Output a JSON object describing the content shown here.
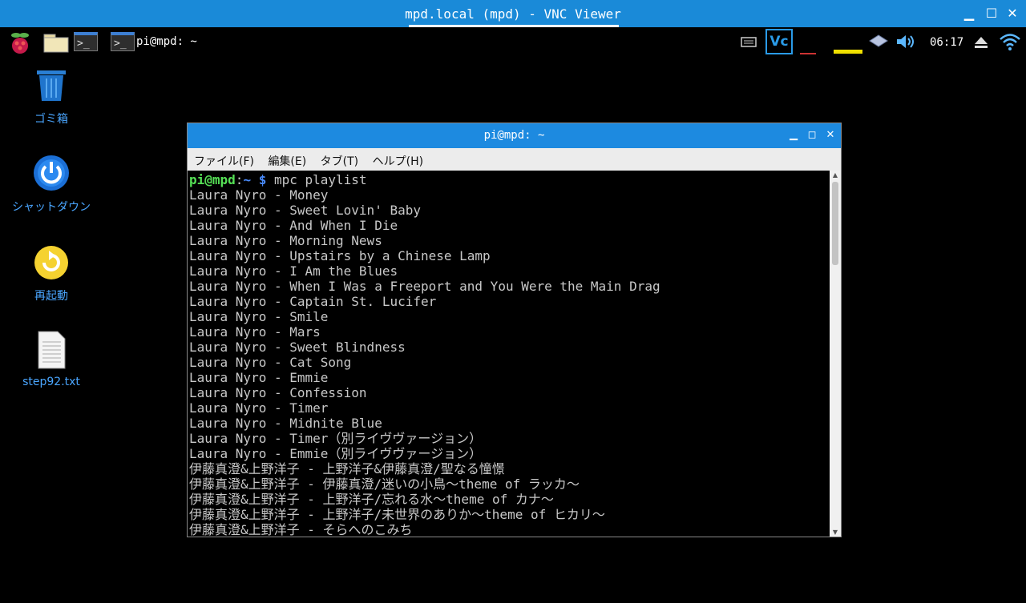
{
  "vnc_window": {
    "title": "mpd.local (mpd) - VNC Viewer"
  },
  "taskbar": {
    "active_task_label": "pi@mpd: ~",
    "clock": "06:17",
    "vnc_badge": "Vc"
  },
  "desktop_icons": [
    {
      "label": "ゴミ箱"
    },
    {
      "label": "シャットダウン"
    },
    {
      "label": "再起動"
    },
    {
      "label": "step92.txt"
    }
  ],
  "terminal": {
    "title": "pi@mpd: ~",
    "menu": [
      "ファイル(F)",
      "編集(E)",
      "タブ(T)",
      "ヘルプ(H)"
    ],
    "prompt_user": "pi@mpd",
    "prompt_sep": ":",
    "prompt_path": "~ $",
    "command": " mpc playlist",
    "lines": [
      "Laura Nyro - Money",
      "Laura Nyro - Sweet Lovin' Baby",
      "Laura Nyro - And When I Die",
      "Laura Nyro - Morning News",
      "Laura Nyro - Upstairs by a Chinese Lamp",
      "Laura Nyro - I Am the Blues",
      "Laura Nyro - When I Was a Freeport and You Were the Main Drag",
      "Laura Nyro - Captain St. Lucifer",
      "Laura Nyro - Smile",
      "Laura Nyro - Mars",
      "Laura Nyro - Sweet Blindness",
      "Laura Nyro - Cat Song",
      "Laura Nyro - Emmie",
      "Laura Nyro - Confession",
      "Laura Nyro - Timer",
      "Laura Nyro - Midnite Blue",
      "Laura Nyro - Timer（別ライヴヴァージョン）",
      "Laura Nyro - Emmie（別ライヴヴァージョン）",
      "伊藤真澄&上野洋子 - 上野洋子&伊藤真澄/聖なる憧憬",
      "伊藤真澄&上野洋子 - 伊藤真澄/迷いの小鳥～theme of ラッカ～",
      "伊藤真澄&上野洋子 - 上野洋子/忘れる水～theme of カナ～",
      "伊藤真澄&上野洋子 - 上野洋子/未世界のありか～theme of ヒカリ～",
      "伊藤真澄&上野洋子 - そらへのこみち"
    ]
  }
}
